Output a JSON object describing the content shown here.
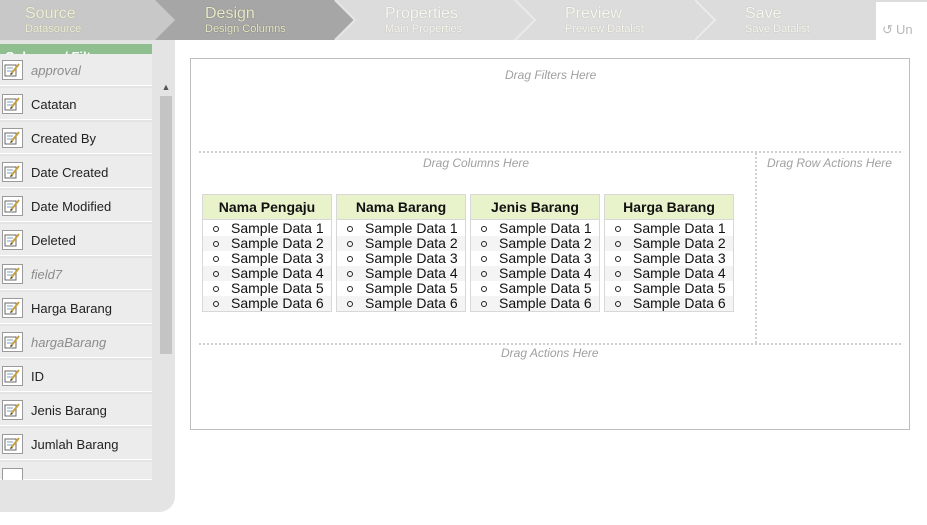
{
  "wizard": {
    "steps": [
      {
        "title": "Source",
        "subtitle": "Datasource"
      },
      {
        "title": "Design",
        "subtitle": "Design Columns"
      },
      {
        "title": "Properties",
        "subtitle": "Main Properties"
      },
      {
        "title": "Preview",
        "subtitle": "Preview Datalist"
      },
      {
        "title": "Save",
        "subtitle": "Save Datalist"
      }
    ],
    "active_step": "Design",
    "undo_label": "Un"
  },
  "palette": {
    "heading": "Columns / Filters",
    "fields": [
      {
        "label": "approval",
        "italic": true
      },
      {
        "label": "Catatan",
        "italic": false
      },
      {
        "label": "Created By",
        "italic": false
      },
      {
        "label": "Date Created",
        "italic": false
      },
      {
        "label": "Date Modified",
        "italic": false
      },
      {
        "label": "Deleted",
        "italic": false
      },
      {
        "label": "field7",
        "italic": true
      },
      {
        "label": "Harga Barang",
        "italic": false
      },
      {
        "label": "hargaBarang",
        "italic": true
      },
      {
        "label": "ID",
        "italic": false
      },
      {
        "label": "Jenis Barang",
        "italic": false
      },
      {
        "label": "Jumlah Barang",
        "italic": false
      }
    ]
  },
  "canvas": {
    "filters_hint": "Drag Filters Here",
    "columns_hint": "Drag Columns Here",
    "row_actions_hint": "Drag Row Actions Here",
    "actions_hint": "Drag Actions Here",
    "columns": [
      {
        "header": "Nama Pengaju",
        "rows": [
          "Sample Data 1",
          "Sample Data 2",
          "Sample Data 3",
          "Sample Data 4",
          "Sample Data 5",
          "Sample Data 6"
        ]
      },
      {
        "header": "Nama Barang",
        "rows": [
          "Sample Data 1",
          "Sample Data 2",
          "Sample Data 3",
          "Sample Data 4",
          "Sample Data 5",
          "Sample Data 6"
        ]
      },
      {
        "header": "Jenis Barang",
        "rows": [
          "Sample Data 1",
          "Sample Data 2",
          "Sample Data 3",
          "Sample Data 4",
          "Sample Data 5",
          "Sample Data 6"
        ]
      },
      {
        "header": "Harga Barang",
        "rows": [
          "Sample Data 1",
          "Sample Data 2",
          "Sample Data 3",
          "Sample Data 4",
          "Sample Data 5",
          "Sample Data 6"
        ]
      }
    ]
  },
  "icons": {
    "field_icon": "edit-form-icon",
    "undo_icon": "undo-icon",
    "scroll_up": "arrow-up-icon",
    "scroll_down": "arrow-down-icon"
  },
  "colors": {
    "palette_header": "#8fbf8f",
    "column_header": "#e8f3cc",
    "wizard_active": "#a6a6a6",
    "wizard_done": "#c8c8c8",
    "wizard_todo": "#dcdcdc"
  }
}
